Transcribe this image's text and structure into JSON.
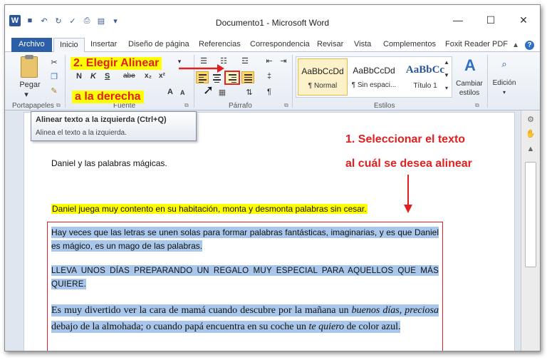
{
  "window": {
    "title": "Documento1 - Microsoft Word",
    "minimize": "—",
    "maximize": "☐",
    "close": "✕"
  },
  "tabs": [
    {
      "label": "Archivo"
    },
    {
      "label": "Inicio"
    },
    {
      "label": "Insertar"
    },
    {
      "label": "Diseño de página"
    },
    {
      "label": "Referencias"
    },
    {
      "label": "Correspondencia"
    },
    {
      "label": "Revisar"
    },
    {
      "label": "Vista"
    },
    {
      "label": "Complementos"
    },
    {
      "label": "Foxit Reader PDF"
    }
  ],
  "ribbon": {
    "paste_label": "Pegar",
    "group_clipboard": "Portapapeles",
    "group_font": "Fuente",
    "group_paragraph": "Párrafo",
    "group_styles": "Estilos",
    "bold": "N",
    "italic": "K",
    "underline": "S",
    "strike": "abe",
    "subscript": "x₂",
    "superscript": "x²",
    "grow_font": "A",
    "shrink_font": "A",
    "show_marks": "¶",
    "styles": [
      {
        "sample": "AaBbCcDd",
        "name": "¶ Normal"
      },
      {
        "sample": "AaBbCcDd",
        "name": "¶ Sin espaci..."
      },
      {
        "sample": "AaBbCc",
        "name": "Título 1"
      }
    ],
    "change_styles": "Cambiar estilos",
    "editing": "Edición"
  },
  "tooltip": {
    "title": "Alinear texto a la izquierda (Ctrl+Q)",
    "body": "Alinea el texto a la izquierda."
  },
  "document": {
    "title_line": "Daniel y las palabras mágicas.",
    "highlight_line": "Daniel juega muy contento en su habitación, monta y desmonta palabras sin cesar.",
    "para1": "Hay veces que las letras se unen solas para formar palabras fantásticas, imaginarias, y es que Daniel es mágico, es un mago de las palabras.",
    "para2": "LLEVA UNOS DÍAS PREPARANDO UN REGALO MUY ESPECIAL PARA AQUELLOS QUE MÁS QUIERE.",
    "para3_a": "Es muy divertido ver la cara de mamá cuando descubre por la mañana un ",
    "para3_b": "buenos días, preciosa",
    "para3_c": " debajo de la almohada; o cuando papá encuentra en su coche un ",
    "para3_d": "te quiero",
    "para3_e": " de color azul."
  },
  "annotations": {
    "step2_line1": "2. Elegir Alinear",
    "step2_line2": "a la derecha",
    "step1_line1": "1. Seleccionar el texto",
    "step1_line2": "al cuál se desea alinear"
  },
  "colors": {
    "accent": "#2c5fa8",
    "annotation": "#e02020",
    "selection": "#a8c7ea",
    "highlight": "#ffff00"
  }
}
